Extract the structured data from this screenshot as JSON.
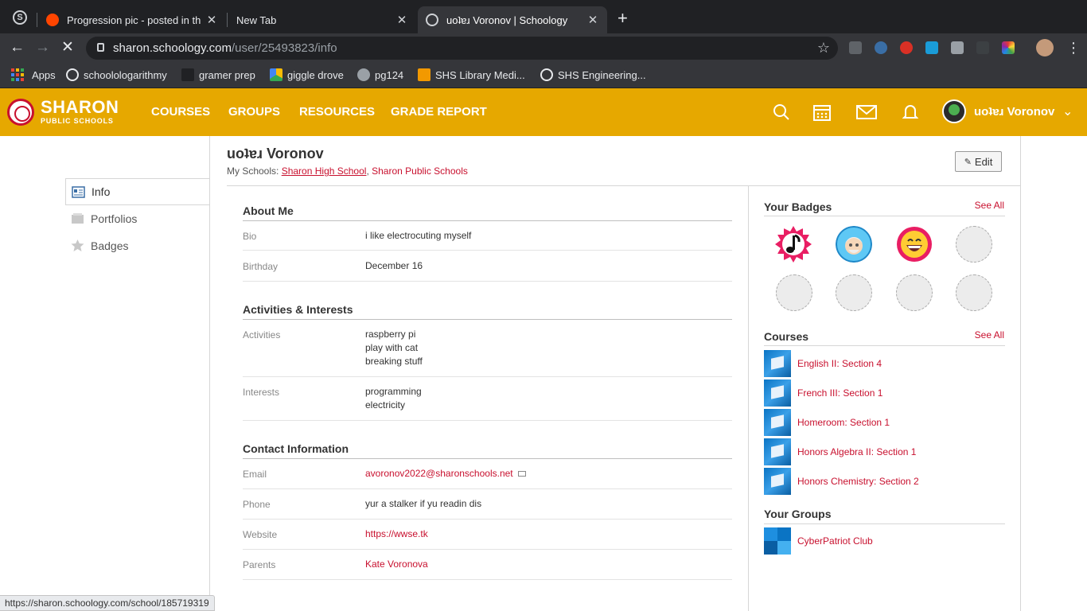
{
  "browser": {
    "tabs": [
      {
        "title": "Progression pic - posted in the"
      },
      {
        "title": "New Tab"
      },
      {
        "title": "uoʇɐɹ Voronov | Schoology"
      }
    ],
    "url_host": "sharon.schoology.com",
    "url_path": "/user/25493823/info",
    "bookmarks": [
      {
        "label": "Apps"
      },
      {
        "label": "schoolologarithmy"
      },
      {
        "label": "gramer prep"
      },
      {
        "label": "giggle drove"
      },
      {
        "label": "pg124"
      },
      {
        "label": "SHS Library Medi..."
      },
      {
        "label": "SHS Engineering..."
      }
    ],
    "status_url": "https://sharon.schoology.com/school/185719319"
  },
  "header": {
    "logo_main": "SHARON",
    "logo_sub": "PUBLIC SCHOOLS",
    "nav": [
      "COURSES",
      "GROUPS",
      "RESOURCES",
      "GRADE REPORT"
    ],
    "user_name": "uoʇɐɹ Voronov",
    "brand_color": "#e6a800"
  },
  "leftnav": {
    "items": [
      {
        "label": "Info",
        "icon": "info-card-icon"
      },
      {
        "label": "Portfolios",
        "icon": "portfolio-icon"
      },
      {
        "label": "Badges",
        "icon": "star-icon"
      }
    ]
  },
  "profile": {
    "name": "uoʇɐɹ Voronov",
    "schools_prefix": "My Schools:",
    "school_primary": "Sharon High School",
    "school_separator": ",",
    "school_secondary": "Sharon Public Schools",
    "edit_label": "Edit"
  },
  "about": {
    "title": "About Me",
    "bio_label": "Bio",
    "bio_value": "i like electrocuting myself",
    "birthday_label": "Birthday",
    "birthday_value": "December 16"
  },
  "activities": {
    "title": "Activities & Interests",
    "activities_label": "Activities",
    "activities_values": [
      "raspberry pi",
      "play with cat",
      "breaking stuff"
    ],
    "interests_label": "Interests",
    "interests_values": [
      "programming",
      "electricity"
    ]
  },
  "contact": {
    "title": "Contact Information",
    "email_label": "Email",
    "email_value": "avoronov2022@sharonschools.net",
    "phone_label": "Phone",
    "phone_value": "yur a stalker if yu readin dis",
    "website_label": "Website",
    "website_value": "https://wwse.tk",
    "parents_label": "Parents",
    "parents_value": "Kate Voronova"
  },
  "sidebar": {
    "badges_title": "Your Badges",
    "badges_see_all": "See All",
    "badges": [
      "music-note-badge-icon",
      "grandpa-badge-icon",
      "laughing-face-badge-icon"
    ],
    "courses_title": "Courses",
    "courses_see_all": "See All",
    "courses": [
      "English II: Section 4",
      "French III: Section 1",
      "Homeroom: Section 1",
      "Honors Algebra II: Section 1",
      "Honors Chemistry: Section 2"
    ],
    "groups_title": "Your Groups",
    "groups": [
      "CyberPatriot Club"
    ]
  }
}
